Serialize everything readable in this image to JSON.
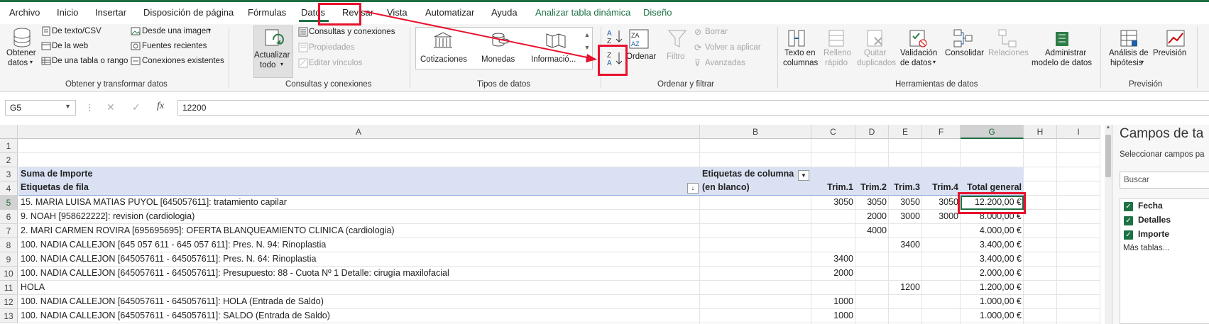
{
  "tabs": [
    "Archivo",
    "Inicio",
    "Insertar",
    "Disposición de página",
    "Fórmulas",
    "Datos",
    "Revisar",
    "Vista",
    "Automatizar",
    "Ayuda",
    "Analizar tabla dinámica",
    "Diseño"
  ],
  "ribbon": {
    "obtener_datos": [
      "Obtener",
      "datos"
    ],
    "texto_csv": "De texto/CSV",
    "web": "De la web",
    "tabla_rango": "De una tabla o rango",
    "desde_imagen": "Desde una imagen",
    "fuentes_recientes": "Fuentes recientes",
    "conexiones_existentes": "Conexiones existentes",
    "group_obtener": "Obtener y transformar datos",
    "actualizar": [
      "Actualizar",
      "todo"
    ],
    "consultas_conexiones": "Consultas y conexiones",
    "propiedades": "Propiedades",
    "editar_vinculos": "Editar vínculos",
    "group_consultas": "Consultas y conexiones",
    "cotizaciones": "Cotizaciones",
    "monedas": "Monedas",
    "informacion": "Informació...",
    "group_tipos": "Tipos de datos",
    "ordenar": "Ordenar",
    "filtro": "Filtro",
    "borrar": "Borrar",
    "volver_aplicar": "Volver a aplicar",
    "avanzadas": "Avanzadas",
    "group_ordenar": "Ordenar y filtrar",
    "texto_columnas": [
      "Texto en",
      "columnas"
    ],
    "relleno_rapido": [
      "Relleno",
      "rápido"
    ],
    "quitar_duplicados": [
      "Quitar",
      "duplicados"
    ],
    "validacion": [
      "Validación",
      "de datos"
    ],
    "consolidar": "Consolidar",
    "relaciones": "Relaciones",
    "admin_modelo": [
      "Administrar",
      "modelo de datos"
    ],
    "group_herramientas": "Herramientas de datos",
    "analisis_hipotesis": [
      "Análisis de",
      "hipótesis"
    ],
    "prevision": "Previsión",
    "group_prevision": "Previsión"
  },
  "formula_bar": {
    "name_box": "G5",
    "value": "12200"
  },
  "columns": [
    "A",
    "B",
    "C",
    "D",
    "E",
    "F",
    "G",
    "H",
    "I"
  ],
  "rows": [
    "1",
    "2",
    "3",
    "4",
    "5",
    "6",
    "7",
    "8",
    "9",
    "10",
    "11",
    "12",
    "13"
  ],
  "pivot": {
    "sum_label": "Suma de Importe",
    "col_labels": "Etiquetas de columna",
    "row_labels": "Etiquetas de fila",
    "blank": "(en blanco)",
    "headers": [
      "Trim.1",
      "Trim.2",
      "Trim.3",
      "Trim.4",
      "Total general"
    ],
    "data": [
      {
        "label": "15. MARIA LUISA MATIAS PUYOL [645057611]: tratamiento capilar",
        "c": "3050",
        "d": "3050",
        "e": "3050",
        "f": "3050",
        "g": "12.200,00 €"
      },
      {
        "label": "9. NOAH  [958622222]: revision (cardiologia)",
        "c": "",
        "d": "2000",
        "e": "3000",
        "f": "3000",
        "g": "8.000,00 €"
      },
      {
        "label": "2. MARI CARMEN ROVIRA [695695695]: OFERTA BLANQUEAMIENTO CLINICA (cardiologia)",
        "c": "",
        "d": "4000",
        "e": "",
        "f": "",
        "g": "4.000,00 €"
      },
      {
        "label": "100. NADIA CALLEJON [645 057 611 - 645 057 611]: Pres. N. 94: Rinoplastia",
        "c": "",
        "d": "",
        "e": "3400",
        "f": "",
        "g": "3.400,00 €"
      },
      {
        "label": "100. NADIA CALLEJON [645057611 - 645057611]: Pres. N. 64: Rinoplastia",
        "c": "3400",
        "d": "",
        "e": "",
        "f": "",
        "g": "3.400,00 €"
      },
      {
        "label": "100. NADIA CALLEJON [645057611 - 645057611]: Presupuesto: 88 - Cuota Nº 1 Detalle: cirugía maxilofacial",
        "c": "2000",
        "d": "",
        "e": "",
        "f": "",
        "g": "2.000,00 €"
      },
      {
        "label": "HOLA",
        "c": "",
        "d": "",
        "e": "1200",
        "f": "",
        "g": "1.200,00 €"
      },
      {
        "label": "100. NADIA CALLEJON [645057611 - 645057611]: HOLA (Entrada de Saldo)",
        "c": "1000",
        "d": "",
        "e": "",
        "f": "",
        "g": "1.000,00 €"
      },
      {
        "label": "100. NADIA CALLEJON [645057611 - 645057611]: SALDO (Entrada de Saldo)",
        "c": "1000",
        "d": "",
        "e": "",
        "f": "",
        "g": "1.000,00 €"
      }
    ]
  },
  "pane": {
    "title": "Campos de ta",
    "subtitle": "Seleccionar campos pa",
    "search_placeholder": "Buscar",
    "fields": [
      "Fecha",
      "Detalles",
      "Importe"
    ],
    "more": "Más tablas..."
  },
  "colors": {
    "excel_green": "#1e7145",
    "annotation_red": "#e8112d",
    "pivot_header": "#d9e1f2"
  }
}
